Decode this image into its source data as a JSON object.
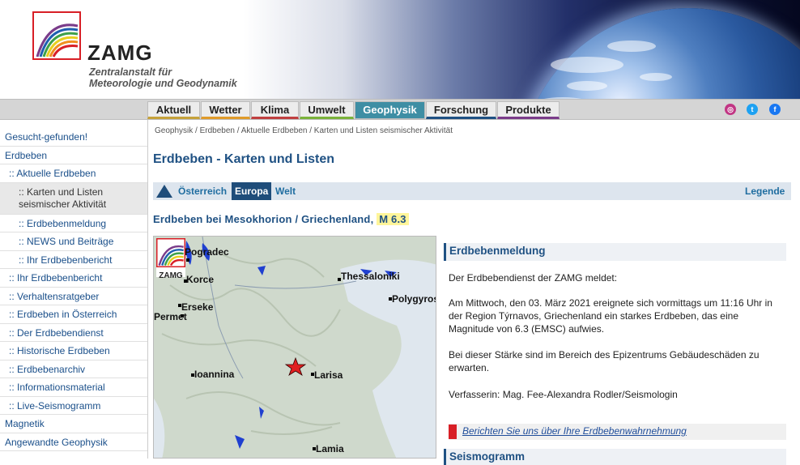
{
  "brand": {
    "name": "ZAMG",
    "subtitle_line1": "Zentralanstalt für",
    "subtitle_line2": "Meteorologie und Geodynamik"
  },
  "nav": {
    "tabs": [
      {
        "label": "Aktuell",
        "accent": "#c5a13a"
      },
      {
        "label": "Wetter",
        "accent": "#e09b2a"
      },
      {
        "label": "Klima",
        "accent": "#c04040"
      },
      {
        "label": "Umwelt",
        "accent": "#7ab23a"
      },
      {
        "label": "Geophysik",
        "accent": "#3e8ea4",
        "active": true
      },
      {
        "label": "Forschung",
        "accent": "#1f5183"
      },
      {
        "label": "Produkte",
        "accent": "#7a3c8a"
      }
    ],
    "social": [
      "instagram-icon",
      "twitter-icon",
      "facebook-icon"
    ]
  },
  "sidebar": {
    "items": [
      {
        "label": "Gesucht-gefunden!"
      },
      {
        "label": "Erdbeben"
      },
      {
        "label": "::  Aktuelle Erdbeben"
      },
      {
        "label_line1": ":: Karten und Listen",
        "label_line2": "seismischer Aktivität",
        "active": true
      },
      {
        "label": ":: Erdbebenmeldung"
      },
      {
        "label": "::  NEWS und Beiträge"
      },
      {
        "label": ":: Ihr Erdbebenbericht"
      },
      {
        "label": ":: Ihr Erdbebenbericht"
      },
      {
        "label": ":: Verhaltensratgeber"
      },
      {
        "label": ":: Erdbeben in Österreich"
      },
      {
        "label": ":: Der Erdbebendienst"
      },
      {
        "label": ":: Historische Erdbeben"
      },
      {
        "label": ":: Erdbebenarchiv"
      },
      {
        "label": ":: Informationsmaterial"
      },
      {
        "label": ":: Live-Seismogramm"
      },
      {
        "label": "Magnetik"
      },
      {
        "label": "Angewandte Geophysik"
      }
    ]
  },
  "breadcrumb": "Geophysik / Erdbeben / Aktuelle Erdbeben / Karten und Listen seismischer Aktivität",
  "page_title": "Erdbeben - Karten und Listen",
  "regions": {
    "tabs": [
      "Österreich",
      "Europa",
      "Welt"
    ],
    "active": "Europa",
    "legend": "Legende"
  },
  "quake": {
    "title": "Erdbeben bei Mesokhorion / Griechenland,",
    "magnitude": "M 6.3"
  },
  "map": {
    "logo_text": "ZAMG",
    "cities": [
      "Pogradec",
      "Korce",
      "Erseke",
      "Permet",
      "Thessaloniki",
      "Polygyros",
      "Ioannina",
      "Larisa",
      "Lamia"
    ]
  },
  "info": {
    "heading": "Erdbebenmeldung",
    "intro": "Der Erdbebendienst der ZAMG meldet:",
    "p1_l1": "Am Mittwoch, den 03. März 2021 ereignete sich vormittags um 11:16 Uhr in",
    "p1_l2": "der Region Týrnavos, Griechenland ein starkes Erdbeben, das eine",
    "p1_l3": "Magnitude von 6.3 (EMSC) aufwies.",
    "p2_l1": "Bei dieser Stärke sind im Bereich des Epizentrums Gebäudeschäden zu",
    "p2_l2": "erwarten.",
    "author": "Verfasserin: Mag. Fee-Alexandra Rodler/Seismologin",
    "report_link": "Berichten Sie uns über Ihre Erdbebenwahrnehmung",
    "seismogram_heading": "Seismogramm"
  }
}
